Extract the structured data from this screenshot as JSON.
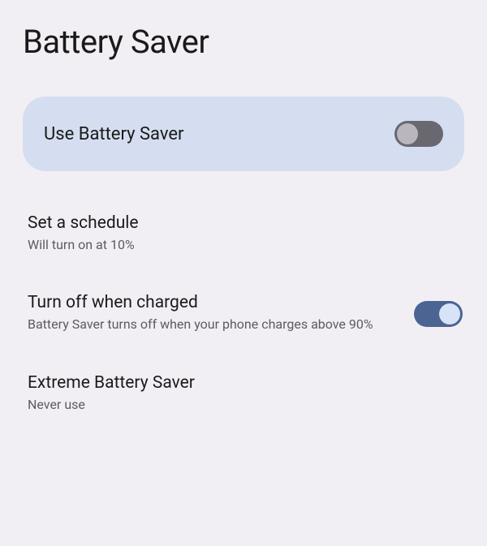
{
  "header": {
    "title": "Battery Saver"
  },
  "main_card": {
    "label": "Use Battery Saver",
    "toggle_on": false
  },
  "settings": [
    {
      "title": "Set a schedule",
      "subtitle": "Will turn on at 10%",
      "has_toggle": false
    },
    {
      "title": "Turn off when charged",
      "subtitle": "Battery Saver turns off when your phone charges above 90%",
      "has_toggle": true,
      "toggle_on": true
    },
    {
      "title": "Extreme Battery Saver",
      "subtitle": "Never use",
      "has_toggle": false
    }
  ]
}
